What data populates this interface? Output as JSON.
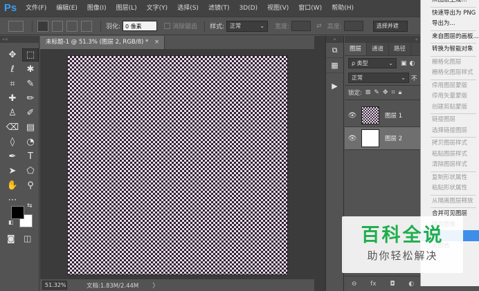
{
  "app": {
    "logo": "Ps"
  },
  "menubar": {
    "items": [
      "文件(F)",
      "编辑(E)",
      "图像(I)",
      "图层(L)",
      "文字(Y)",
      "选择(S)",
      "滤镜(T)",
      "3D(D)",
      "视图(V)",
      "窗口(W)",
      "帮助(H)"
    ]
  },
  "options": {
    "feather_label": "羽化:",
    "feather_value": "0 像素",
    "antialias_label": "消除锯齿",
    "style_label": "样式:",
    "style_value": "正常",
    "width_label": "宽度:",
    "height_label": "高度:",
    "select_mask_label": "选择并遮"
  },
  "document": {
    "tab_title": "未标题-1 @ 51.3% (图层 2, RGB/8) *",
    "close_glyph": "×",
    "zoom": "51.32%",
    "doc_info": "文档:1.83M/2.44M",
    "status_arrow": "〉"
  },
  "layers": {
    "tabs": [
      "图层",
      "通道",
      "路径"
    ],
    "kind_filter": "ρ 类型",
    "blend_mode": "正常",
    "opacity_label": "不",
    "lock_label": "锁定:",
    "items": [
      {
        "name": "图层 1",
        "visible": true,
        "selected": false
      },
      {
        "name": "图层 2",
        "visible": true,
        "selected": true
      }
    ],
    "footer_icons": [
      "link-icon",
      "fx-icon",
      "mask-icon",
      "adjustment-icon"
    ],
    "footer_glyphs": [
      "⊖",
      "fx",
      "◘",
      "◐"
    ]
  },
  "context_menu": {
    "items": [
      {
        "label": "从图层生成...",
        "disabled": false,
        "highlight": false
      },
      {
        "sep": true
      },
      {
        "label": "快速导出为 PNG",
        "disabled": false,
        "highlight": false
      },
      {
        "label": "导出为...",
        "disabled": false,
        "highlight": false
      },
      {
        "sep": true
      },
      {
        "label": "来自图层的画板...",
        "disabled": false,
        "highlight": false
      },
      {
        "sep": true
      },
      {
        "label": "转换为智能对象",
        "disabled": false,
        "highlight": false
      },
      {
        "sep": true
      },
      {
        "label": "栅格化图层",
        "disabled": true,
        "highlight": false
      },
      {
        "label": "栅格化图层样式",
        "disabled": true,
        "highlight": false
      },
      {
        "sep": true
      },
      {
        "label": "停用图层蒙版",
        "disabled": true,
        "highlight": false
      },
      {
        "label": "停用矢量蒙版",
        "disabled": true,
        "highlight": false
      },
      {
        "label": "创建剪贴蒙版",
        "disabled": true,
        "highlight": false
      },
      {
        "sep": true
      },
      {
        "label": "链接图层",
        "disabled": true,
        "highlight": false
      },
      {
        "label": "选择链接图层",
        "disabled": true,
        "highlight": false
      },
      {
        "sep": true
      },
      {
        "label": "拷贝图层样式",
        "disabled": true,
        "highlight": false
      },
      {
        "label": "粘贴图层样式",
        "disabled": true,
        "highlight": false
      },
      {
        "label": "清除图层样式",
        "disabled": true,
        "highlight": false
      },
      {
        "sep": true
      },
      {
        "label": "复制形状属性",
        "disabled": true,
        "highlight": false
      },
      {
        "label": "粘贴形状属性",
        "disabled": true,
        "highlight": false
      },
      {
        "sep": true
      },
      {
        "label": "从隔离图层释放",
        "disabled": true,
        "highlight": false
      },
      {
        "sep": true
      },
      {
        "label": "合并可见图层",
        "disabled": false,
        "highlight": false
      },
      {
        "label": "拼合图像",
        "disabled": false,
        "highlight": false
      },
      {
        "label": "",
        "disabled": false,
        "highlight": true
      },
      {
        "label": "无颜色",
        "disabled": false,
        "highlight": false
      }
    ]
  },
  "watermark": {
    "title": "百科全说",
    "subtitle": "助你轻松解决"
  },
  "colors": {
    "foreground": "#000000",
    "background": "#ffffff",
    "accent": "#3d8ee8",
    "watermark_green": "#1fae4e"
  },
  "tools": [
    {
      "name": "move-tool-icon",
      "glyph": "✥"
    },
    {
      "name": "marquee-tool-icon",
      "glyph": "⬚",
      "active": true
    },
    {
      "name": "lasso-tool-icon",
      "glyph": "ℓ"
    },
    {
      "name": "magic-wand-icon",
      "glyph": "✱"
    },
    {
      "name": "crop-tool-icon",
      "glyph": "⌗"
    },
    {
      "name": "eyedropper-icon",
      "glyph": "✎"
    },
    {
      "name": "healing-brush-icon",
      "glyph": "✚"
    },
    {
      "name": "brush-tool-icon",
      "glyph": "✏"
    },
    {
      "name": "stamp-tool-icon",
      "glyph": "♙"
    },
    {
      "name": "history-brush-icon",
      "glyph": "✐"
    },
    {
      "name": "eraser-tool-icon",
      "glyph": "⌫"
    },
    {
      "name": "gradient-tool-icon",
      "glyph": "▤"
    },
    {
      "name": "blur-tool-icon",
      "glyph": "◊"
    },
    {
      "name": "dodge-tool-icon",
      "glyph": "◔"
    },
    {
      "name": "pen-tool-icon",
      "glyph": "✒"
    },
    {
      "name": "type-tool-icon",
      "glyph": "T"
    },
    {
      "name": "path-select-icon",
      "glyph": "➤"
    },
    {
      "name": "shape-tool-icon",
      "glyph": "⬠"
    },
    {
      "name": "hand-tool-icon",
      "glyph": "✋"
    },
    {
      "name": "zoom-tool-icon",
      "glyph": "⚲"
    },
    {
      "name": "more-tools-icon",
      "glyph": "⋯"
    },
    {
      "name": "blank",
      "glyph": ""
    }
  ]
}
